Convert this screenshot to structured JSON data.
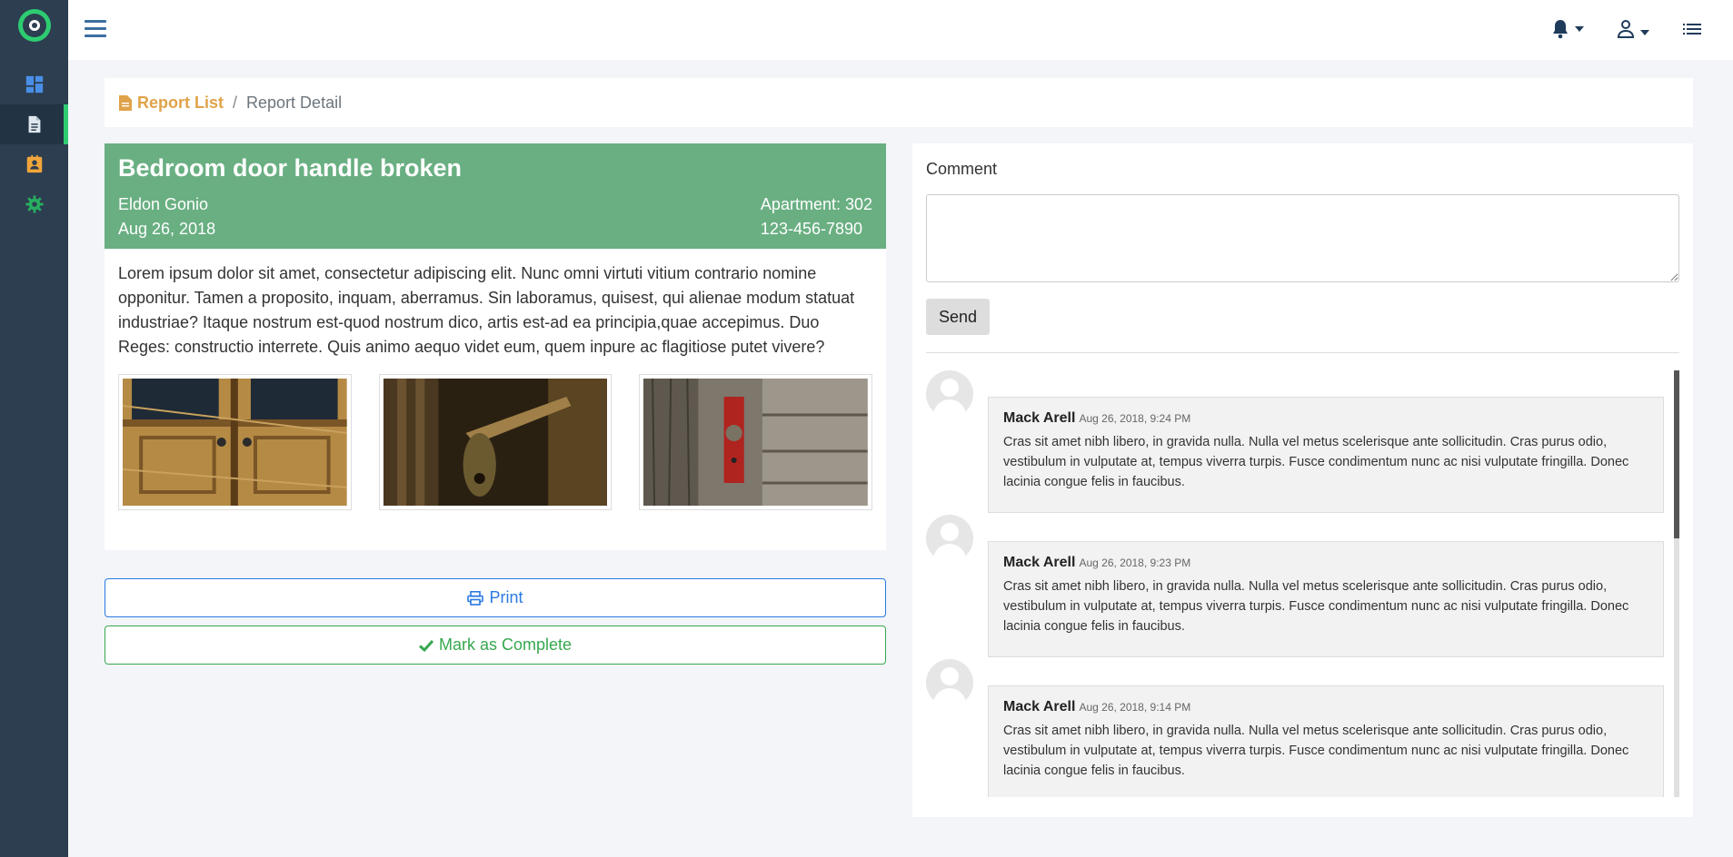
{
  "sidebar": {
    "logo": "logo-icon",
    "items": [
      {
        "name": "dashboard",
        "icon": "dashboard-icon",
        "color": "#4a8fe7"
      },
      {
        "name": "reports",
        "icon": "document-icon",
        "color": "#ffffff",
        "active": true
      },
      {
        "name": "contacts",
        "icon": "contact-card-icon",
        "color": "#f0a63a"
      },
      {
        "name": "settings",
        "icon": "gear-icon",
        "color": "#27ae60"
      }
    ]
  },
  "topbar": {
    "menu_icon": "hamburger-icon",
    "notifications_icon": "bell-icon",
    "user_icon": "user-icon",
    "list_icon": "list-icon"
  },
  "breadcrumb": {
    "link": "Report List",
    "current": "Report Detail"
  },
  "report": {
    "title": "Bedroom door handle broken",
    "reporter": "Eldon Gonio",
    "date": "Aug 26, 2018",
    "apartment": "Apartment: 302",
    "phone": "123-456-7890",
    "body": "Lorem ipsum dolor sit amet, consectetur adipiscing elit. Nunc omni virtuti vitium contrario nomine opponitur. Tamen a proposito, inquam, aberramus. Sin laboramus, quisest, qui alienae modum statuat industriae? Itaque nostrum est-quod nostrum dico, artis est-ad ea principia,quae accepimus. Duo Reges: constructio interrete. Quis animo aequo videt eum, quem inpure ac flagitiose putet vivere?",
    "header_color": "#69af82"
  },
  "actions": {
    "print": "Print",
    "complete": "Mark as Complete"
  },
  "comments_panel": {
    "label": "Comment",
    "placeholder": "",
    "send": "Send",
    "items": [
      {
        "author": "Mack Arell",
        "time": "Aug 26, 2018, 9:24 PM",
        "text": "Cras sit amet nibh libero, in gravida nulla. Nulla vel metus scelerisque ante sollicitudin. Cras purus odio, vestibulum in vulputate at, tempus viverra turpis. Fusce condimentum nunc ac nisi vulputate fringilla. Donec lacinia congue felis in faucibus."
      },
      {
        "author": "Mack Arell",
        "time": "Aug 26, 2018, 9:23 PM",
        "text": "Cras sit amet nibh libero, in gravida nulla. Nulla vel metus scelerisque ante sollicitudin. Cras purus odio, vestibulum in vulputate at, tempus viverra turpis. Fusce condimentum nunc ac nisi vulputate fringilla. Donec lacinia congue felis in faucibus."
      },
      {
        "author": "Mack Arell",
        "time": "Aug 26, 2018, 9:14 PM",
        "text": "Cras sit amet nibh libero, in gravida nulla. Nulla vel metus scelerisque ante sollicitudin. Cras purus odio, vestibulum in vulputate at, tempus viverra turpis. Fusce condimentum nunc ac nisi vulputate fringilla. Donec lacinia congue felis in faucibus."
      }
    ]
  }
}
